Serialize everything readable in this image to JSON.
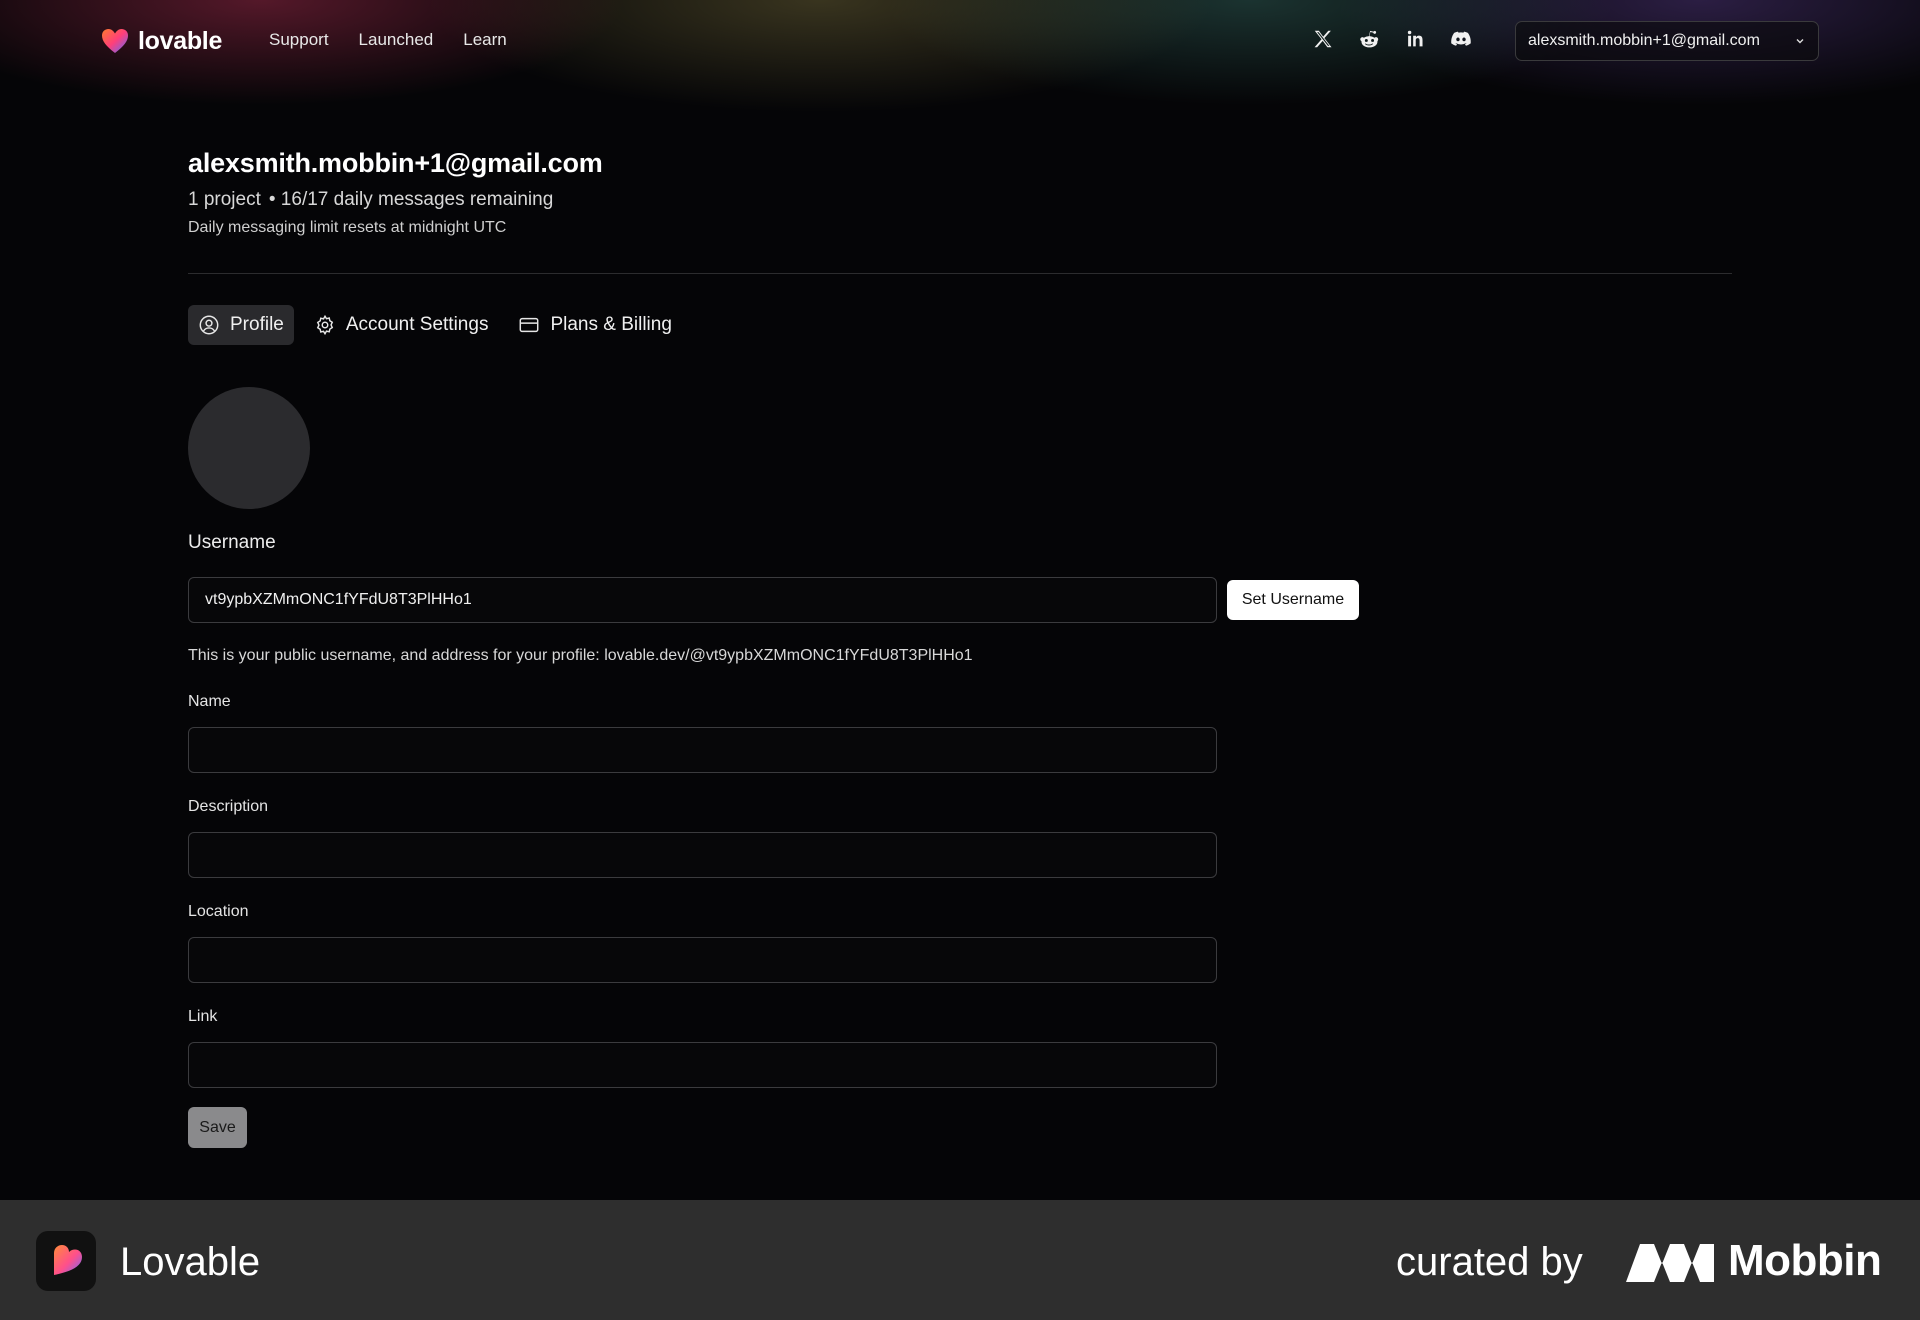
{
  "nav": {
    "brand": "lovable",
    "links": [
      "Support",
      "Launched",
      "Learn"
    ],
    "social_icons": [
      "x-icon",
      "reddit-icon",
      "linkedin-icon",
      "discord-icon"
    ],
    "user_email": "alexsmith.mobbin+1@gmail.com"
  },
  "header": {
    "title": "alexsmith.mobbin+1@gmail.com",
    "projects": "1 project",
    "messages": "• 16/17 daily messages remaining",
    "reset_note": "Daily messaging limit resets at midnight UTC"
  },
  "tabs": [
    {
      "label": "Profile",
      "icon": "user-circle-icon",
      "active": true
    },
    {
      "label": "Account Settings",
      "icon": "gear-icon",
      "active": false
    },
    {
      "label": "Plans & Billing",
      "icon": "credit-card-icon",
      "active": false
    }
  ],
  "profile": {
    "username_label": "Username",
    "username_value": "vt9ypbXZMmONC1fYFdU8T3PlHHo1",
    "set_username_label": "Set Username",
    "helper_text": "This is your public username, and address for your profile: lovable.dev/@vt9ypbXZMmONC1fYFdU8T3PlHHo1",
    "name_label": "Name",
    "name_value": "",
    "description_label": "Description",
    "description_value": "",
    "location_label": "Location",
    "location_value": "",
    "link_label": "Link",
    "link_value": "",
    "save_label": "Save"
  },
  "footer": {
    "app_name": "Lovable",
    "curated_by": "curated by",
    "curator": "Mobbin"
  },
  "colors": {
    "background": "#050507",
    "footer": "#2e2e2e",
    "active_tab": "#2a2a2d",
    "avatar": "#2b2b2e",
    "save_button": "#8a8a8c"
  }
}
